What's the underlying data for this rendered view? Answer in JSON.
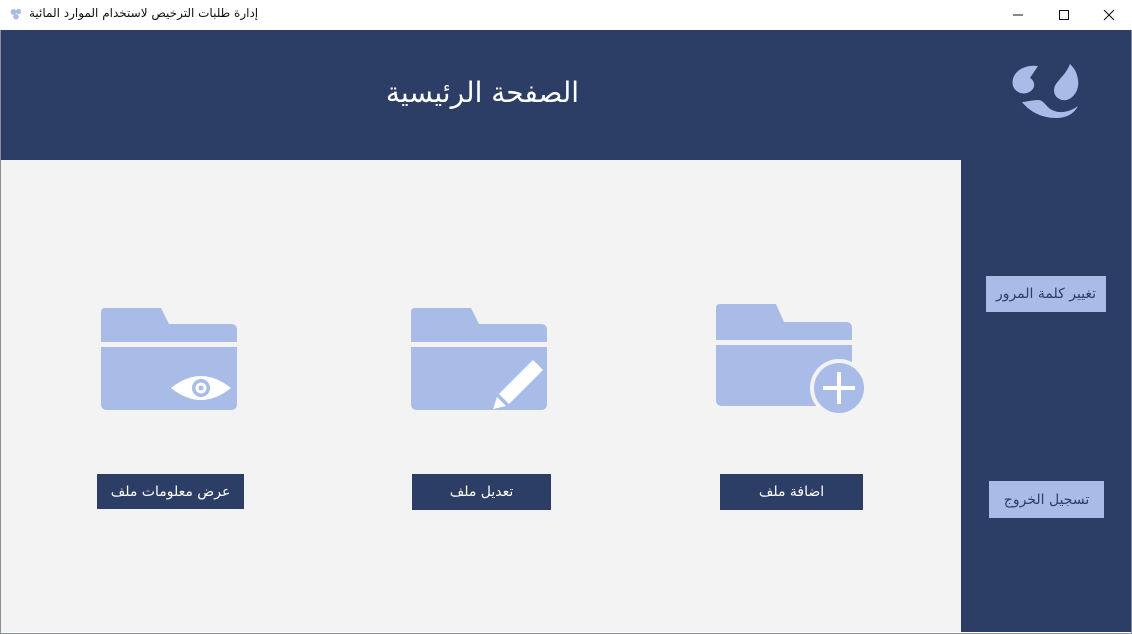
{
  "window": {
    "title": "إدارة طلبات الترخيص لاستخدام الموارد المائية",
    "controls": [
      "minimize-icon",
      "maximize-icon",
      "close-icon"
    ]
  },
  "header": {
    "title": "الصفحة الرئيسية",
    "logo_icon": "water-drops-logo-icon"
  },
  "sidebar": {
    "change_password_label": "تغيير كلمة المرور",
    "logout_label": "تسجيل الخروج"
  },
  "actions": {
    "view": {
      "label": "عرض معلومات ملف",
      "icon": "folder-eye-icon"
    },
    "edit": {
      "label": "تعديل ملف",
      "icon": "folder-pencil-icon"
    },
    "add": {
      "label": "اضافة ملف",
      "icon": "folder-plus-icon"
    }
  },
  "colors": {
    "primary": "#2c3e66",
    "accent": "#a9bce8",
    "background": "#f3f3f3"
  }
}
